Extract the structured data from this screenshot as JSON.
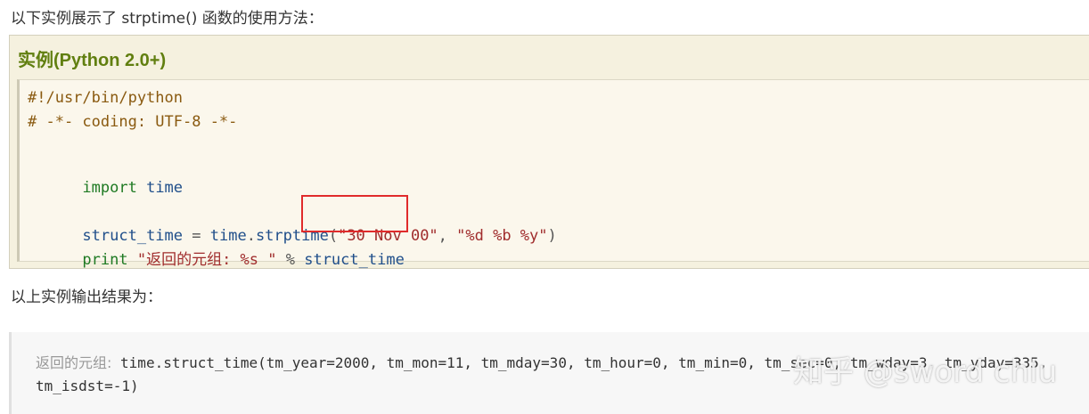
{
  "intro_text": "以下实例展示了 strptime() 函数的使用方法：",
  "example": {
    "title": "实例(Python 2.0+)",
    "code": {
      "line1": "#!/usr/bin/python",
      "line2": "# -*- coding: UTF-8 -*-",
      "line4_kw": "import",
      "line4_mod": " time",
      "line6_a": "struct_time",
      "line6_b": " = ",
      "line6_c": "time",
      "line6_d": ".",
      "line6_e": "strptime",
      "line6_f": "(",
      "line6_g": "\"30 Nov 00\"",
      "line6_h": ", ",
      "line6_i": "\"%d %b %y\"",
      "line6_j": ")",
      "line7_kw": "print",
      "line7_str": " \"返回的元组: %s \"",
      "line7_op": " % ",
      "line7_var": "struct_time"
    }
  },
  "result_intro": "以上实例输出结果为：",
  "output": {
    "cn_label": "返回的元组:",
    "line1": " time.struct_time(tm_year=2000, tm_mon=11, tm_mday=30, tm_hour=0, tm_min=0, tm_sec=0, tm_wday=3, tm_yday=335,",
    "line2": "tm_isdst=-1)"
  },
  "watermark": "知乎 @sword chiu",
  "colors": {
    "title_green": "#617f10",
    "highlight_red": "#e02b2b",
    "box_bg": "#f5f1df"
  }
}
